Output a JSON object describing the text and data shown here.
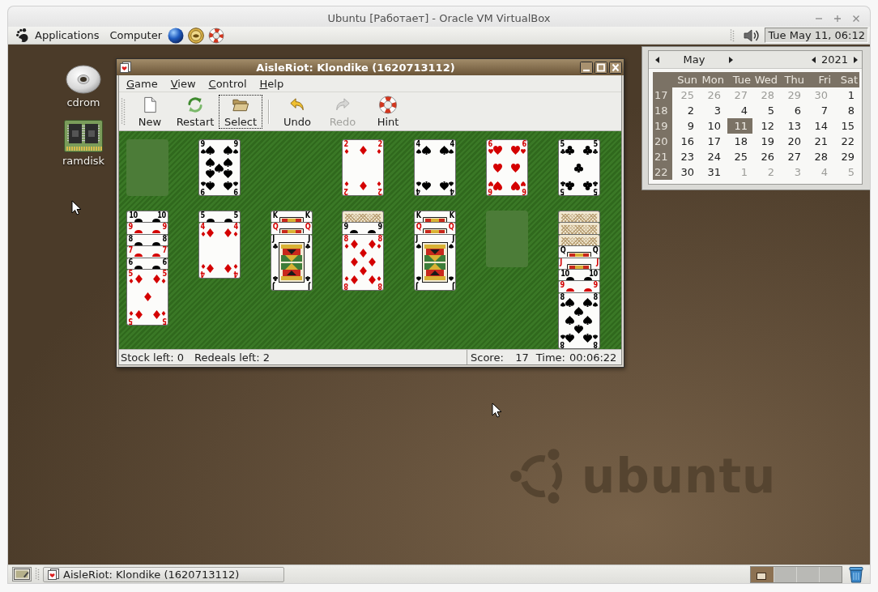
{
  "window": {
    "title": "Ubuntu [Работает] - Oracle VM VirtualBox"
  },
  "top_panel": {
    "menus": [
      "Applications",
      "Computer"
    ],
    "clock": {
      "label": "Tue May 11, 06:12",
      "pressed": true
    }
  },
  "desktop_icons": [
    {
      "label": "cdrom"
    },
    {
      "label": "ramdisk"
    }
  ],
  "game_window": {
    "title": "AisleRiot: Klondike (1620713112)",
    "menu": [
      "Game",
      "View",
      "Control",
      "Help"
    ],
    "toolbar_groups": [
      {
        "buttons": [
          {
            "label": "New",
            "disabled": false,
            "focused": false
          },
          {
            "label": "Restart",
            "disabled": false,
            "focused": false
          },
          {
            "label": "Select",
            "disabled": false,
            "focused": true
          }
        ]
      },
      {
        "buttons": [
          {
            "label": "Undo",
            "disabled": false,
            "focused": false
          },
          {
            "label": "Redo",
            "disabled": true,
            "focused": false
          },
          {
            "label": "Hint",
            "disabled": false,
            "focused": false
          }
        ]
      }
    ],
    "board": {
      "stock": {
        "empty": true
      },
      "waste": {
        "empty": false,
        "cards": [
          {
            "face_up": true,
            "face": false,
            "kind": "spades",
            "color": "#000000",
            "corners": [
              "9",
              "9",
              "9",
              "9"
            ],
            "pips": [
              {
                "kind": "spades",
                "upright": true
              },
              {
                "kind": "spades",
                "upright": true
              },
              {
                "kind": "spades",
                "upright": true
              },
              {
                "kind": "spades",
                "upright": true
              },
              {
                "kind": "spades",
                "upright": true
              },
              {
                "kind": "spades",
                "upright": false
              },
              {
                "kind": "spades",
                "upright": false
              },
              {
                "kind": "spades",
                "upright": false
              },
              {
                "kind": "spades",
                "upright": false
              }
            ]
          }
        ]
      },
      "foundations": [
        {
          "empty": false,
          "cards": [
            {
              "face_up": true,
              "face": false,
              "kind": "diamonds",
              "color": "#d40000",
              "corners": [
                "2",
                "2",
                "2",
                "2"
              ],
              "pips": [
                {
                  "kind": "diamonds"
                },
                {
                  "kind": "diamonds"
                }
              ]
            }
          ]
        },
        {
          "empty": false,
          "cards": [
            {
              "face_up": true,
              "face": false,
              "kind": "spades",
              "color": "#000000",
              "corners": [
                "4",
                "4",
                "4",
                "4"
              ],
              "pips": [
                {
                  "kind": "spades",
                  "upright": true
                },
                {
                  "kind": "spades",
                  "upright": true
                },
                {
                  "kind": "spades",
                  "upright": false
                },
                {
                  "kind": "spades",
                  "upright": false
                }
              ]
            }
          ]
        },
        {
          "empty": false,
          "cards": [
            {
              "face_up": true,
              "face": false,
              "kind": "hearts",
              "color": "#d40000",
              "corners": [
                "6",
                "6",
                "6",
                "6"
              ],
              "pips": [
                {
                  "kind": "hearts",
                  "upright": true
                },
                {
                  "kind": "hearts",
                  "upright": true
                },
                {
                  "kind": "hearts",
                  "upright": true
                },
                {
                  "kind": "hearts",
                  "upright": true
                },
                {
                  "kind": "hearts",
                  "upright": false
                },
                {
                  "kind": "hearts",
                  "upright": false
                }
              ]
            }
          ]
        },
        {
          "empty": false,
          "cards": [
            {
              "face_up": true,
              "face": false,
              "kind": "clubs",
              "color": "#000000",
              "corners": [
                "5",
                "5",
                "5",
                "5"
              ],
              "pips": [
                {
                  "kind": "clubs",
                  "upright": true
                },
                {
                  "kind": "clubs",
                  "upright": true
                },
                {
                  "kind": "clubs",
                  "upright": true
                },
                {
                  "kind": "clubs",
                  "upright": false
                },
                {
                  "kind": "clubs",
                  "upright": false
                }
              ]
            }
          ]
        }
      ],
      "tableau": [
        {
          "empty": false,
          "cards": [
            {
              "face_up": true,
              "face": false,
              "color": "#000000",
              "corners": [
                "10",
                "10"
              ],
              "pips": [
                {
                  "upright": true
                },
                {
                  "upright": true
                }
              ]
            },
            {
              "face_up": true,
              "face": false,
              "color": "#d40000",
              "corners": [
                "9",
                "9"
              ],
              "pips": [
                {
                  "upright": true
                },
                {
                  "upright": true
                }
              ]
            },
            {
              "face_up": true,
              "face": false,
              "color": "#000000",
              "corners": [
                "8",
                "8"
              ],
              "pips": [
                {
                  "upright": true
                },
                {
                  "upright": true
                }
              ]
            },
            {
              "face_up": true,
              "face": false,
              "color": "#d40000",
              "corners": [
                "7",
                "7"
              ],
              "pips": [
                {
                  "upright": true
                },
                {
                  "upright": true
                }
              ]
            },
            {
              "face_up": true,
              "face": false,
              "color": "#000000",
              "corners": [
                "6",
                "6"
              ],
              "pips": [
                {
                  "upright": true
                },
                {
                  "upright": true
                }
              ]
            },
            {
              "face_up": true,
              "face": false,
              "kind": "diamonds",
              "color": "#d40000",
              "corners": [
                "5",
                "5",
                "5",
                "5"
              ],
              "pips": [
                {
                  "kind": "diamonds"
                },
                {
                  "kind": "diamonds"
                },
                {
                  "kind": "diamonds"
                },
                {
                  "kind": "diamonds"
                },
                {
                  "kind": "diamonds"
                }
              ]
            }
          ]
        },
        {
          "empty": false,
          "cards": [
            {
              "face_up": true,
              "face": false,
              "color": "#000000",
              "corners": [
                "5",
                "5"
              ],
              "pips": [
                {
                  "upright": true
                },
                {
                  "upright": true
                }
              ]
            },
            {
              "face_up": true,
              "face": false,
              "kind": "diamonds",
              "color": "#d40000",
              "corners": [
                "4",
                "4",
                "4",
                "4"
              ],
              "pips": [
                {
                  "kind": "diamonds"
                },
                {
                  "kind": "diamonds"
                },
                {
                  "kind": "diamonds"
                },
                {
                  "kind": "diamonds"
                }
              ]
            }
          ]
        },
        {
          "empty": false,
          "cards": [
            {
              "face_up": true,
              "face": true,
              "color": "#000000",
              "corners": [
                "K",
                "K"
              ]
            },
            {
              "face_up": true,
              "face": true,
              "color": "#d40000",
              "corners": [
                "Q",
                "Q"
              ]
            },
            {
              "face_up": true,
              "face": true,
              "kind": "clubs",
              "color": "#000000",
              "corners": [
                "J",
                "J",
                "J",
                "J"
              ]
            }
          ]
        },
        {
          "empty": false,
          "cards": [
            {
              "face_up": false
            },
            {
              "face_up": true,
              "face": false,
              "color": "#000000",
              "corners": [
                "9",
                "9"
              ],
              "pips": [
                {
                  "upright": true
                },
                {
                  "upright": true
                }
              ]
            },
            {
              "face_up": true,
              "face": false,
              "kind": "diamonds",
              "color": "#d40000",
              "corners": [
                "8",
                "8",
                "8",
                "8"
              ],
              "pips": [
                {
                  "kind": "diamonds"
                },
                {
                  "kind": "diamonds"
                },
                {
                  "kind": "diamonds"
                },
                {
                  "kind": "diamonds"
                },
                {
                  "kind": "diamonds"
                },
                {
                  "kind": "diamonds"
                },
                {
                  "kind": "diamonds"
                },
                {
                  "kind": "diamonds"
                }
              ]
            }
          ]
        },
        {
          "empty": false,
          "cards": [
            {
              "face_up": true,
              "face": true,
              "color": "#000000",
              "corners": [
                "K",
                "K"
              ]
            },
            {
              "face_up": true,
              "face": true,
              "color": "#d40000",
              "corners": [
                "Q",
                "Q"
              ]
            },
            {
              "face_up": true,
              "face": true,
              "kind": "spades",
              "color": "#000000",
              "corners": [
                "J",
                "J",
                "J",
                "J"
              ]
            }
          ]
        },
        {
          "empty": true
        },
        {
          "empty": false,
          "cards": [
            {
              "face_up": false
            },
            {
              "face_up": false
            },
            {
              "face_up": false
            },
            {
              "face_up": true,
              "face": true,
              "color": "#000000",
              "corners": [
                "Q",
                "Q"
              ]
            },
            {
              "face_up": true,
              "face": true,
              "color": "#d40000",
              "corners": [
                "J",
                "J"
              ]
            },
            {
              "face_up": true,
              "face": false,
              "color": "#000000",
              "corners": [
                "10",
                "10"
              ],
              "pips": [
                {
                  "upright": true
                },
                {
                  "upright": true
                }
              ]
            },
            {
              "face_up": true,
              "face": false,
              "color": "#d40000",
              "corners": [
                "9",
                "9"
              ],
              "pips": [
                {
                  "upright": true
                },
                {
                  "upright": true
                }
              ]
            },
            {
              "face_up": true,
              "face": false,
              "kind": "spades",
              "color": "#000000",
              "corners": [
                "8",
                "8",
                "8",
                "8"
              ],
              "pips": [
                {
                  "kind": "spades",
                  "upright": true
                },
                {
                  "kind": "spades",
                  "upright": true
                },
                {
                  "kind": "spades",
                  "upright": true
                },
                {
                  "kind": "spades",
                  "upright": true
                },
                {
                  "kind": "spades",
                  "upright": true
                },
                {
                  "kind": "spades",
                  "upright": false
                },
                {
                  "kind": "spades",
                  "upright": false
                },
                {
                  "kind": "spades",
                  "upright": false
                }
              ]
            }
          ]
        }
      ]
    },
    "status_bar": {
      "stock": "Stock left: 0",
      "redeals": "Redeals left: 2",
      "score_label": "Score:",
      "score": "17",
      "time_label": "Time:",
      "time": "00:06:22"
    }
  },
  "calendar": {
    "month": "May",
    "year": "2021",
    "weekdays": [
      "Sun",
      "Mon",
      "Tue",
      "Wed",
      "Thu",
      "Fri",
      "Sat"
    ],
    "weeks": [
      {
        "number": "17",
        "days": [
          {
            "day": "25",
            "other_month": true,
            "selected": false
          },
          {
            "day": "26",
            "other_month": true,
            "selected": false
          },
          {
            "day": "27",
            "other_month": true,
            "selected": false
          },
          {
            "day": "28",
            "other_month": true,
            "selected": false
          },
          {
            "day": "29",
            "other_month": true,
            "selected": false
          },
          {
            "day": "30",
            "other_month": true,
            "selected": false
          },
          {
            "day": "1",
            "other_month": false,
            "selected": false
          }
        ]
      },
      {
        "number": "18",
        "days": [
          {
            "day": "2",
            "other_month": false,
            "selected": false
          },
          {
            "day": "3",
            "other_month": false,
            "selected": false
          },
          {
            "day": "4",
            "other_month": false,
            "selected": false
          },
          {
            "day": "5",
            "other_month": false,
            "selected": false
          },
          {
            "day": "6",
            "other_month": false,
            "selected": false
          },
          {
            "day": "7",
            "other_month": false,
            "selected": false
          },
          {
            "day": "8",
            "other_month": false,
            "selected": false
          }
        ]
      },
      {
        "number": "19",
        "days": [
          {
            "day": "9",
            "other_month": false,
            "selected": false
          },
          {
            "day": "10",
            "other_month": false,
            "selected": false
          },
          {
            "day": "11",
            "other_month": false,
            "selected": true
          },
          {
            "day": "12",
            "other_month": false,
            "selected": false
          },
          {
            "day": "13",
            "other_month": false,
            "selected": false
          },
          {
            "day": "14",
            "other_month": false,
            "selected": false
          },
          {
            "day": "15",
            "other_month": false,
            "selected": false
          }
        ]
      },
      {
        "number": "20",
        "days": [
          {
            "day": "16",
            "other_month": false,
            "selected": false
          },
          {
            "day": "17",
            "other_month": false,
            "selected": false
          },
          {
            "day": "18",
            "other_month": false,
            "selected": false
          },
          {
            "day": "19",
            "other_month": false,
            "selected": false
          },
          {
            "day": "20",
            "other_month": false,
            "selected": false
          },
          {
            "day": "21",
            "other_month": false,
            "selected": false
          },
          {
            "day": "22",
            "other_month": false,
            "selected": false
          }
        ]
      },
      {
        "number": "21",
        "days": [
          {
            "day": "23",
            "other_month": false,
            "selected": false
          },
          {
            "day": "24",
            "other_month": false,
            "selected": false
          },
          {
            "day": "25",
            "other_month": false,
            "selected": false
          },
          {
            "day": "26",
            "other_month": false,
            "selected": false
          },
          {
            "day": "27",
            "other_month": false,
            "selected": false
          },
          {
            "day": "28",
            "other_month": false,
            "selected": false
          },
          {
            "day": "29",
            "other_month": false,
            "selected": false
          }
        ]
      },
      {
        "number": "22",
        "days": [
          {
            "day": "30",
            "other_month": false,
            "selected": false
          },
          {
            "day": "31",
            "other_month": false,
            "selected": false
          },
          {
            "day": "1",
            "other_month": true,
            "selected": false
          },
          {
            "day": "2",
            "other_month": true,
            "selected": false
          },
          {
            "day": "3",
            "other_month": true,
            "selected": false
          },
          {
            "day": "4",
            "other_month": true,
            "selected": false
          },
          {
            "day": "5",
            "other_month": true,
            "selected": false
          }
        ]
      }
    ]
  },
  "bottom_panel": {
    "tasks": [
      {
        "label": "AisleRiot: Klondike (1620713112)",
        "selected": false
      }
    ],
    "workspaces": [
      {
        "selected": true
      },
      {
        "selected": false
      },
      {
        "selected": false
      },
      {
        "selected": false
      }
    ]
  },
  "wallpaper_logo": "ubuntu"
}
